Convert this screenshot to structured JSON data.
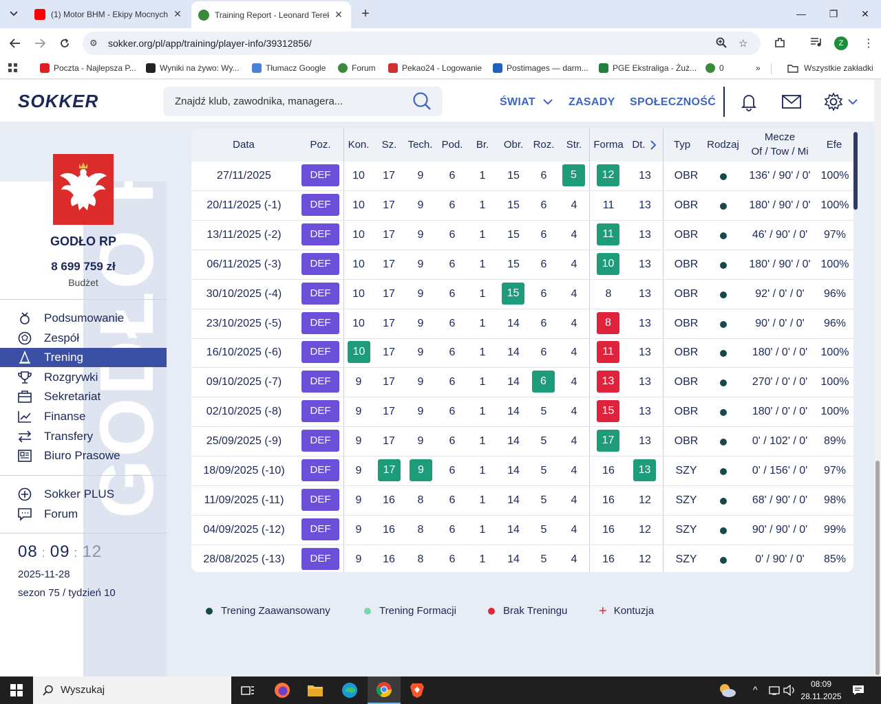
{
  "browser": {
    "tabs": [
      {
        "title": "(1) Motor BHM - Ekipy Mocnych",
        "favicon_color": "#ff0000"
      },
      {
        "title": "Training Report - Leonard Terek",
        "favicon_color": "#3a8a3a"
      }
    ],
    "url": "sokker.org/pl/app/training/player-info/39312856/",
    "profile_initial": "Z",
    "bookmarks": [
      {
        "label": "Poczta - Najlepsza P...",
        "color": "#e02020"
      },
      {
        "label": "Wyniki na żywo: Wy...",
        "color": "#222222"
      },
      {
        "label": "Tłumacz Google",
        "color": "#4a7fe0"
      },
      {
        "label": "Forum",
        "color": "#3a8a3a"
      },
      {
        "label": "Pekao24 - Logowanie",
        "color": "#d03030"
      },
      {
        "label": "Postimages — darm...",
        "color": "#2060c0"
      },
      {
        "label": "PGE Ekstraliga - Żuż...",
        "color": "#208040"
      },
      {
        "label": "0",
        "color": "#3a8a3a"
      }
    ],
    "all_bookmarks": "Wszystkie zakładki"
  },
  "header": {
    "logo": "SOKKER",
    "search_placeholder": "Znajdź klub, zawodnika, managera...",
    "nav": [
      "ŚWIAT",
      "ZASADY",
      "SPOŁECZNOŚĆ"
    ]
  },
  "sidebar": {
    "club_name": "GODŁO RP",
    "budget": "8 699 759 zł",
    "budget_label": "Budżet",
    "watermark": "GODŁO RP",
    "menu": [
      "Podsumowanie",
      "Zespół",
      "Trening",
      "Rozgrywki",
      "Sekretariat",
      "Finanse",
      "Transfery",
      "Biuro Prasowe"
    ],
    "menu2": [
      "Sokker PLUS",
      "Forum"
    ],
    "clock_h": "08",
    "clock_m": "09",
    "clock_s": "12",
    "date": "2025-11-28",
    "season": "sezon 75 / tydzień 10"
  },
  "table": {
    "headers": {
      "date": "Data",
      "pos": "Poz.",
      "kon": "Kon.",
      "sz": "Sz.",
      "tech": "Tech.",
      "pod": "Pod.",
      "br": "Br.",
      "obr": "Obr.",
      "roz": "Roz.",
      "str": "Str.",
      "forma": "Forma",
      "dt": "Dt.",
      "typ": "Typ",
      "rodzaj": "Rodzaj",
      "mecze": "Mecze",
      "mecze_sub": "Of / Tow / Mi",
      "efe": "Efe"
    },
    "rows": [
      {
        "date": "27/11/2025",
        "pos": "DEF",
        "kon": "10",
        "sz": "17",
        "tech": "9",
        "pod": "6",
        "br": "1",
        "obr": "15",
        "roz": "6",
        "str": "5",
        "forma": "12",
        "dt": "13",
        "typ": "OBR",
        "mecze": "136' / 90' / 0'",
        "efe": "100%",
        "hl": {
          "str": "green",
          "forma": "green"
        }
      },
      {
        "date": "20/11/2025 (-1)",
        "pos": "DEF",
        "kon": "10",
        "sz": "17",
        "tech": "9",
        "pod": "6",
        "br": "1",
        "obr": "15",
        "roz": "6",
        "str": "4",
        "forma": "11",
        "dt": "13",
        "typ": "OBR",
        "mecze": "180' / 90' / 0'",
        "efe": "100%",
        "hl": {}
      },
      {
        "date": "13/11/2025 (-2)",
        "pos": "DEF",
        "kon": "10",
        "sz": "17",
        "tech": "9",
        "pod": "6",
        "br": "1",
        "obr": "15",
        "roz": "6",
        "str": "4",
        "forma": "11",
        "dt": "13",
        "typ": "OBR",
        "mecze": "46' / 90' / 0'",
        "efe": "97%",
        "hl": {
          "forma": "green"
        }
      },
      {
        "date": "06/11/2025 (-3)",
        "pos": "DEF",
        "kon": "10",
        "sz": "17",
        "tech": "9",
        "pod": "6",
        "br": "1",
        "obr": "15",
        "roz": "6",
        "str": "4",
        "forma": "10",
        "dt": "13",
        "typ": "OBR",
        "mecze": "180' / 90' / 0'",
        "efe": "100%",
        "hl": {
          "forma": "green"
        }
      },
      {
        "date": "30/10/2025 (-4)",
        "pos": "DEF",
        "kon": "10",
        "sz": "17",
        "tech": "9",
        "pod": "6",
        "br": "1",
        "obr": "15",
        "roz": "6",
        "str": "4",
        "forma": "8",
        "dt": "13",
        "typ": "OBR",
        "mecze": "92' / 0' / 0'",
        "efe": "96%",
        "hl": {
          "obr": "green"
        }
      },
      {
        "date": "23/10/2025 (-5)",
        "pos": "DEF",
        "kon": "10",
        "sz": "17",
        "tech": "9",
        "pod": "6",
        "br": "1",
        "obr": "14",
        "roz": "6",
        "str": "4",
        "forma": "8",
        "dt": "13",
        "typ": "OBR",
        "mecze": "90' / 0' / 0'",
        "efe": "96%",
        "hl": {
          "forma": "red"
        }
      },
      {
        "date": "16/10/2025 (-6)",
        "pos": "DEF",
        "kon": "10",
        "sz": "17",
        "tech": "9",
        "pod": "6",
        "br": "1",
        "obr": "14",
        "roz": "6",
        "str": "4",
        "forma": "11",
        "dt": "13",
        "typ": "OBR",
        "mecze": "180' / 0' / 0'",
        "efe": "100%",
        "hl": {
          "kon": "green",
          "forma": "red"
        }
      },
      {
        "date": "09/10/2025 (-7)",
        "pos": "DEF",
        "kon": "9",
        "sz": "17",
        "tech": "9",
        "pod": "6",
        "br": "1",
        "obr": "14",
        "roz": "6",
        "str": "4",
        "forma": "13",
        "dt": "13",
        "typ": "OBR",
        "mecze": "270' / 0' / 0'",
        "efe": "100%",
        "hl": {
          "roz": "green",
          "forma": "red"
        }
      },
      {
        "date": "02/10/2025 (-8)",
        "pos": "DEF",
        "kon": "9",
        "sz": "17",
        "tech": "9",
        "pod": "6",
        "br": "1",
        "obr": "14",
        "roz": "5",
        "str": "4",
        "forma": "15",
        "dt": "13",
        "typ": "OBR",
        "mecze": "180' / 0' / 0'",
        "efe": "100%",
        "hl": {
          "forma": "red"
        }
      },
      {
        "date": "25/09/2025 (-9)",
        "pos": "DEF",
        "kon": "9",
        "sz": "17",
        "tech": "9",
        "pod": "6",
        "br": "1",
        "obr": "14",
        "roz": "5",
        "str": "4",
        "forma": "17",
        "dt": "13",
        "typ": "OBR",
        "mecze": "0' / 102' / 0'",
        "efe": "89%",
        "hl": {
          "forma": "green"
        }
      },
      {
        "date": "18/09/2025 (-10)",
        "pos": "DEF",
        "kon": "9",
        "sz": "17",
        "tech": "9",
        "pod": "6",
        "br": "1",
        "obr": "14",
        "roz": "5",
        "str": "4",
        "forma": "16",
        "dt": "13",
        "typ": "SZY",
        "mecze": "0' / 156' / 0'",
        "efe": "97%",
        "hl": {
          "sz": "green",
          "tech": "green",
          "dt": "green"
        }
      },
      {
        "date": "11/09/2025 (-11)",
        "pos": "DEF",
        "kon": "9",
        "sz": "16",
        "tech": "8",
        "pod": "6",
        "br": "1",
        "obr": "14",
        "roz": "5",
        "str": "4",
        "forma": "16",
        "dt": "12",
        "typ": "SZY",
        "mecze": "68' / 90' / 0'",
        "efe": "98%",
        "hl": {}
      },
      {
        "date": "04/09/2025 (-12)",
        "pos": "DEF",
        "kon": "9",
        "sz": "16",
        "tech": "8",
        "pod": "6",
        "br": "1",
        "obr": "14",
        "roz": "5",
        "str": "4",
        "forma": "16",
        "dt": "12",
        "typ": "SZY",
        "mecze": "90' / 90' / 0'",
        "efe": "99%",
        "hl": {}
      },
      {
        "date": "28/08/2025 (-13)",
        "pos": "DEF",
        "kon": "9",
        "sz": "16",
        "tech": "8",
        "pod": "6",
        "br": "1",
        "obr": "14",
        "roz": "5",
        "str": "4",
        "forma": "16",
        "dt": "12",
        "typ": "SZY",
        "mecze": "0' / 90' / 0'",
        "efe": "85%",
        "hl": {}
      }
    ]
  },
  "legend": [
    {
      "label": "Trening Zaawansowany",
      "color": "#17484a"
    },
    {
      "label": "Trening Formacji",
      "color": "#7fd3b0"
    },
    {
      "label": "Brak Treningu",
      "color": "#d92b3a"
    },
    {
      "label": "Kontuzja",
      "color": "#d92b3a",
      "plus": true
    }
  ],
  "taskbar": {
    "search": "Wyszukaj",
    "time": "08:09",
    "date": "28.11.2025"
  },
  "colors": {
    "accent": "#3d63c7",
    "pos_badge": "#6b4fd8",
    "green": "#1e9c7a",
    "red": "#e0233d",
    "navy": "#1b2756"
  }
}
